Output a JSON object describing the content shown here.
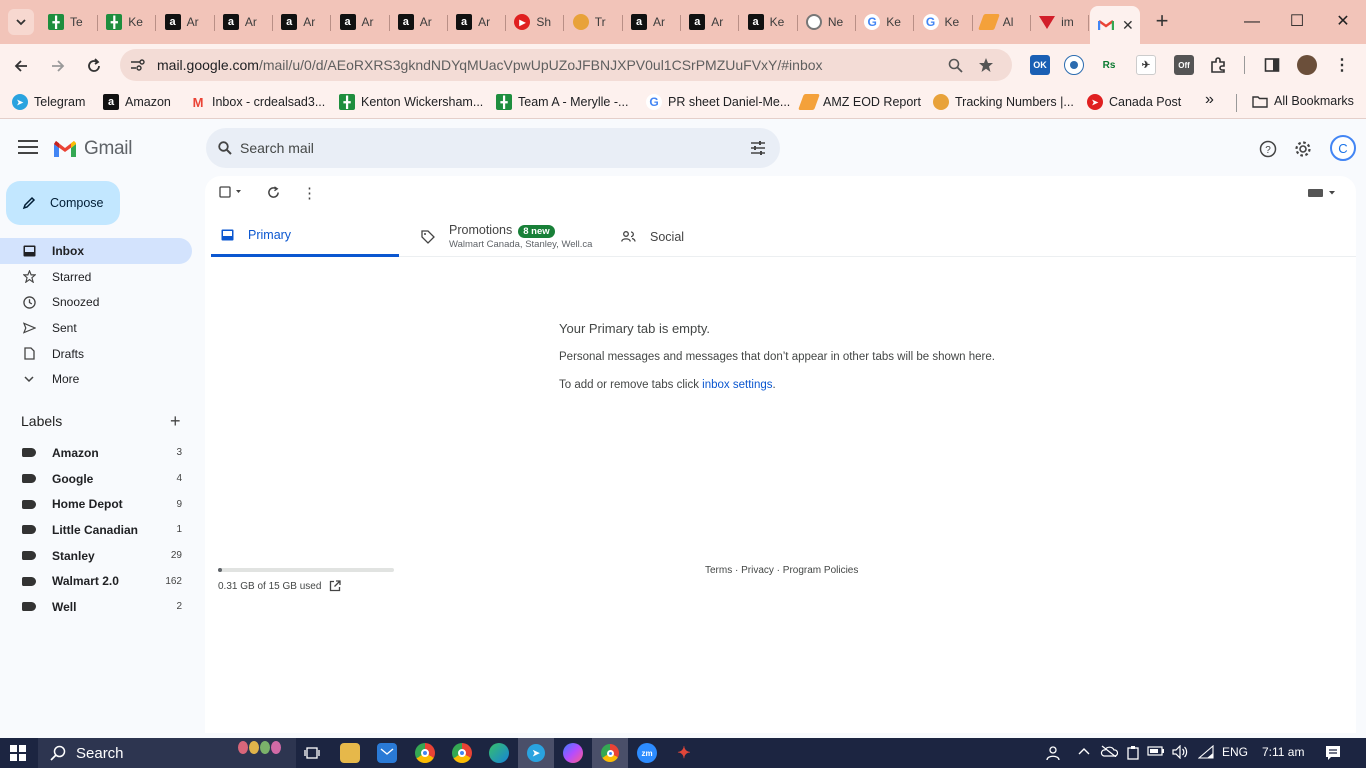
{
  "browser": {
    "tabs": [
      {
        "title": "Te",
        "icon": "sheets-icon"
      },
      {
        "title": "Ke",
        "icon": "sheets-icon"
      },
      {
        "title": "Ar",
        "icon": "amazon-icon"
      },
      {
        "title": "Ar",
        "icon": "amazon-icon"
      },
      {
        "title": "Ar",
        "icon": "amazon-icon"
      },
      {
        "title": "Ar",
        "icon": "amazon-icon"
      },
      {
        "title": "Ar",
        "icon": "amazon-icon"
      },
      {
        "title": "Ar",
        "icon": "amazon-icon"
      },
      {
        "title": "Sh",
        "icon": "youtube-icon"
      },
      {
        "title": "Tr",
        "icon": "taco-icon"
      },
      {
        "title": "Ar",
        "icon": "amazon-icon"
      },
      {
        "title": "Ar",
        "icon": "amazon-icon"
      },
      {
        "title": "Ke",
        "icon": "amazon-icon"
      },
      {
        "title": "Ne",
        "icon": "circle-icon"
      },
      {
        "title": "Ke",
        "icon": "google-icon"
      },
      {
        "title": "Ke",
        "icon": "google-icon"
      },
      {
        "title": "Al",
        "icon": "pen-icon"
      },
      {
        "title": "im",
        "icon": "triangle-icon"
      }
    ],
    "url_host": "mail.google.com",
    "url_path": "/mail/u/0/d/AEoRXRS3gkndNDYqMUacVpwUpUZoJFBNJXPV0ul1CSrPMZUuFVxY/#inbox",
    "bookmarks": [
      {
        "label": "Telegram"
      },
      {
        "label": "Amazon"
      },
      {
        "label": "Inbox - crdealsad3..."
      },
      {
        "label": "Kenton Wickersham..."
      },
      {
        "label": "Team A - Merylle -..."
      },
      {
        "label": "PR sheet Daniel-Me..."
      },
      {
        "label": "AMZ EOD Report"
      },
      {
        "label": "Tracking Numbers |..."
      },
      {
        "label": "Canada Post"
      }
    ],
    "more_bookmarks": "»",
    "all_bookmarks": "All Bookmarks",
    "ext_ok": "OK",
    "ext_rs": "Rs",
    "ext_off": "Off"
  },
  "gmail": {
    "logo_text": "Gmail",
    "search_placeholder": "Search mail",
    "avatar_letter": "C",
    "compose": "Compose",
    "nav": [
      {
        "label": "Inbox"
      },
      {
        "label": "Starred"
      },
      {
        "label": "Snoozed"
      },
      {
        "label": "Sent"
      },
      {
        "label": "Drafts"
      },
      {
        "label": "More"
      }
    ],
    "labels_title": "Labels",
    "labels": [
      {
        "label": "Amazon",
        "count": "3"
      },
      {
        "label": "Google",
        "count": "4"
      },
      {
        "label": "Home Depot",
        "count": "9"
      },
      {
        "label": "Little Canadian",
        "count": "1"
      },
      {
        "label": "Stanley",
        "count": "29"
      },
      {
        "label": "Walmart 2.0",
        "count": "162"
      },
      {
        "label": "Well",
        "count": "2"
      }
    ],
    "tabs": {
      "primary": "Primary",
      "promotions": "Promotions",
      "promotions_badge": "8 new",
      "promotions_sub": "Walmart Canada, Stanley, Well.ca",
      "social": "Social"
    },
    "empty": {
      "title": "Your Primary tab is empty.",
      "line1": "Personal messages and messages that don’t appear in other tabs will be shown here.",
      "line2_prefix": "To add or remove tabs click ",
      "line2_link": "inbox settings",
      "line2_suffix": "."
    },
    "storage": {
      "text": "0.31 GB of 15 GB used",
      "fraction": 0.02
    },
    "footer": "Terms · Privacy · Program Policies"
  },
  "taskbar": {
    "search": "Search",
    "lang": "ENG",
    "time": "7:11 am"
  }
}
